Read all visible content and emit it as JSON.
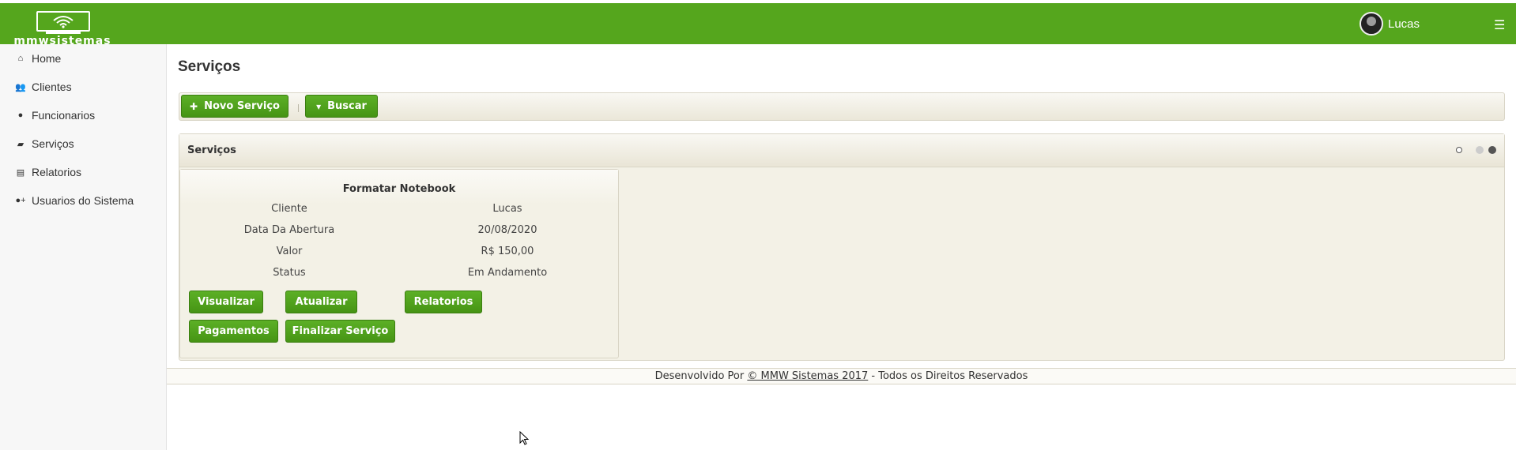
{
  "header": {
    "logo_text": "mmwsistemas",
    "user_name": "Lucas",
    "menu_icon": "hamburger-icon",
    "brand_color": "#55a61d"
  },
  "sidebar": {
    "items": [
      {
        "label": "Home",
        "icon": "home-icon",
        "glyph": "⌂"
      },
      {
        "label": "Clientes",
        "icon": "users-icon",
        "glyph": "👥"
      },
      {
        "label": "Funcionarios",
        "icon": "user-icon",
        "glyph": "●"
      },
      {
        "label": "Serviços",
        "icon": "briefcase-icon",
        "glyph": "▰"
      },
      {
        "label": "Relatorios",
        "icon": "file-icon",
        "glyph": "▤"
      },
      {
        "label": "Usuarios do Sistema",
        "icon": "user-plus-icon",
        "glyph": "●+"
      }
    ]
  },
  "page": {
    "title": "Serviços"
  },
  "toolbar": {
    "new_label": "Novo Serviço",
    "new_icon": "plus-icon",
    "search_label": "Buscar",
    "search_icon": "caret-down-icon"
  },
  "panel": {
    "title": "Serviços"
  },
  "card": {
    "title": "Formatar Notebook",
    "rows": [
      {
        "label": "Cliente",
        "value": "Lucas"
      },
      {
        "label": "Data Da Abertura",
        "value": "20/08/2020"
      },
      {
        "label": "Valor",
        "value": "R$ 150,00"
      },
      {
        "label": "Status",
        "value": "Em Andamento"
      }
    ],
    "buttons": {
      "view": "Visualizar",
      "update": "Atualizar",
      "reports": "Relatorios",
      "payments": "Pagamentos",
      "finish": "Finalizar Serviço"
    }
  },
  "footer": {
    "prefix": "Desenvolvido Por",
    "link": "© MMW Sistemas 2017",
    "suffix": "- Todos os Direitos Reservados"
  }
}
